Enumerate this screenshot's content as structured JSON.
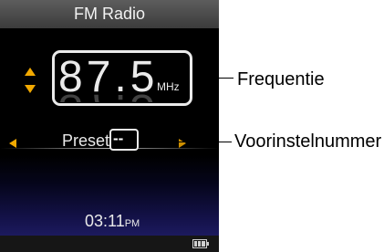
{
  "screen": {
    "title": "FM Radio",
    "frequency": {
      "value": "87.5",
      "display": "87.5",
      "unit": "MHz"
    },
    "preset": {
      "label": "Preset",
      "number": "--"
    },
    "clock": {
      "time": "03:11",
      "ampm": "PM"
    },
    "colors": {
      "accent_arrow": "#f2a900",
      "text": "#eaeaea",
      "bottom_gradient": "#1c1a5e"
    },
    "icons": [
      "up-down-arrows-icon",
      "left-arrow-icon",
      "right-arrow-icon",
      "battery-icon"
    ]
  },
  "callouts": {
    "frequency": "Frequentie",
    "preset_number": "Voorinstelnummer"
  }
}
